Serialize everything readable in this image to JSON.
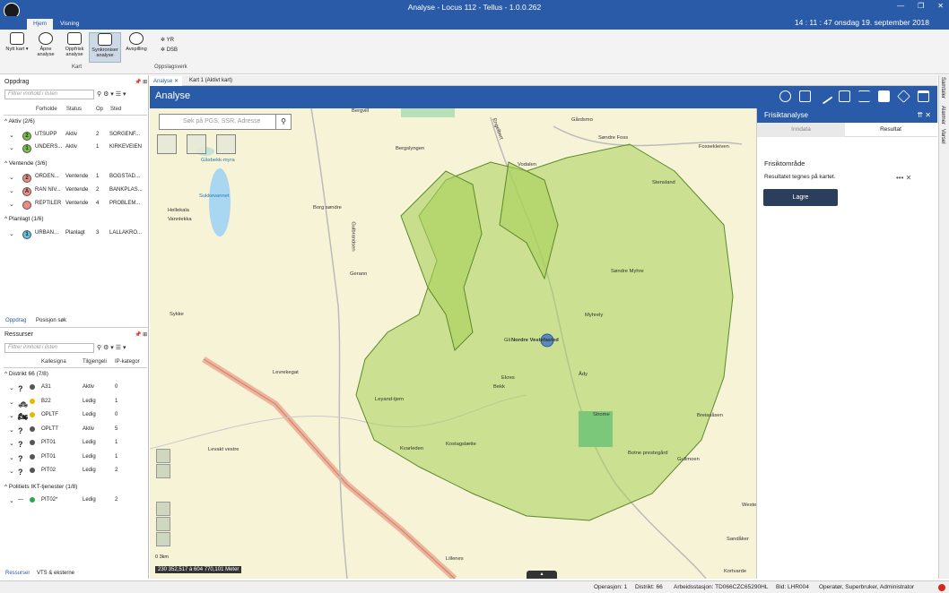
{
  "window": {
    "title": "Analyse - Locus 112 - Tellus - 1.0.0.262",
    "clock": "14 : 11 : 47 onsdag 19. september 2018",
    "controls": [
      "—",
      "❐",
      "✕"
    ]
  },
  "ribbon": {
    "tabs": [
      "Hjem",
      "Visning"
    ],
    "buttons": [
      {
        "label": "Nytt kart ▾"
      },
      {
        "label": "Åpne analyse"
      },
      {
        "label": "Oppfrisk analyse"
      },
      {
        "label": "Synkroniser analyse"
      },
      {
        "label": "Avspilling"
      }
    ],
    "group_kart": "Kart",
    "oppslag": [
      "YR",
      "DSB"
    ],
    "group_oppslag": "Oppslagsverk"
  },
  "oppdrag": {
    "title": "Oppdrag",
    "pin": "📌 ⊞",
    "filter_placeholder": "Filtrer innhold i listen",
    "icons": "⚲ ⚙ ▾ ☰ ▾",
    "columns": [
      "Forholde",
      "Status",
      "Op",
      "Sted"
    ],
    "groups": [
      {
        "title": "Aktiv (2/6)",
        "rows": [
          {
            "badge": "2",
            "color": "#7ac142",
            "name": "UTSUPP",
            "status": "Aktiv",
            "op": "2",
            "sted": "SORGENF..."
          },
          {
            "badge": "1",
            "color": "#7ac142",
            "name": "UNDERS...",
            "status": "Aktiv",
            "op": "1",
            "sted": "KIRKEVEIEN"
          }
        ]
      },
      {
        "title": "Ventende (3/6)",
        "rows": [
          {
            "badge": "2",
            "color": "#f08a7e",
            "name": "ORDEN...",
            "status": "Ventende",
            "op": "1",
            "sted": "BOGSTAD..."
          },
          {
            "badge": "A",
            "color": "#f08a7e",
            "name": "RAN NIV...",
            "status": "Ventende",
            "op": "2",
            "sted": "BANKPLAS..."
          },
          {
            "badge": "",
            "color": "#f08a7e",
            "name": "REPTILER",
            "status": "Ventende",
            "op": "4",
            "sted": "PROBLEM..."
          }
        ]
      },
      {
        "title": "Planlagt (1/6)",
        "rows": [
          {
            "badge": "1",
            "color": "#5bc0de",
            "name": "URBAN...",
            "status": "Planlagt",
            "op": "3",
            "sted": "LALLAKRO..."
          }
        ]
      }
    ],
    "tabs": [
      "Oppdrag",
      "Posisjon søk"
    ]
  },
  "ressurser": {
    "title": "Ressurser",
    "filter_placeholder": "Filtrer innhold i listen",
    "columns": [
      "Kallesigna",
      "Tilgjengeli",
      "IP-kategor"
    ],
    "groups": [
      {
        "title": "Distrikt 66 (7/8)",
        "rows": [
          {
            "icon": "?",
            "dot": "#555",
            "name": "A31",
            "status": "Aktiv",
            "ip": "0"
          },
          {
            "icon": "🚓",
            "dot": "#e6b800",
            "name": "B22",
            "status": "Ledig",
            "ip": "1"
          },
          {
            "icon": "🏍",
            "dot": "#e6b800",
            "name": "OPLTF",
            "status": "Ledig",
            "ip": "0"
          },
          {
            "icon": "?",
            "dot": "#555",
            "name": "OPLTT",
            "status": "Aktiv",
            "ip": "5"
          },
          {
            "icon": "?",
            "dot": "#555",
            "name": "PIT01",
            "status": "Ledig",
            "ip": "1"
          },
          {
            "icon": "?",
            "dot": "#555",
            "name": "PIT01",
            "status": "Ledig",
            "ip": "1"
          },
          {
            "icon": "?",
            "dot": "#555",
            "name": "PIT02",
            "status": "Ledig",
            "ip": "2"
          }
        ]
      },
      {
        "title": "Politiets IKT-tjenester (1/8)",
        "rows": [
          {
            "icon": "—",
            "dot": "#2aa84a",
            "name": "PIT02*",
            "status": "Ledig",
            "ip": "2"
          }
        ]
      }
    ],
    "tabs": [
      "Ressurser",
      "VTS & eksterne"
    ]
  },
  "map": {
    "tabs": [
      "Analyse",
      "Kart 1 (Aktivt kart)"
    ],
    "header": "Analyse",
    "search_placeholder": "Søk på PGS, SSR, Adresse",
    "labels": [
      "Bergvill",
      "Bergslyngen",
      "Gåsbekk-myra",
      "Sukkevannet",
      "Hellekala",
      "Vannlekka",
      "Borg søndre",
      "Gulbrandsen",
      "Gerann",
      "Sykke",
      "Levrekegat",
      "Leyand-tjern",
      "Kvarleden",
      "Kostagslætte",
      "Levakt vestre",
      "Nordre Vestefasted",
      "Gli",
      "Myhrely",
      "Søndre Myhre",
      "Ådy",
      "Ekres",
      "Bekk",
      "Strome",
      "Botne prestegård",
      "Gullmoen",
      "Kortvarde",
      "Sandåker",
      "Fossekleiven",
      "Søndre Foss",
      "Gårdsmo",
      "Stensland",
      "Engelbert",
      "Breiasåsen",
      "Westeråsen",
      "Lillenes",
      "Vodalen"
    ],
    "scale": "0    3km",
    "coords": "230 352,517 à 604 770,101 Meter"
  },
  "frisikt": {
    "title": "Frisiktanalyse",
    "tabs": [
      "Inndata",
      "Resultat"
    ],
    "heading": "Frisiktområde",
    "text": "Resultatet tegnes på kartet.",
    "button": "Lagre",
    "more": "•••  ✕",
    "hcontrols": "⇈  ✕"
  },
  "rightbar": [
    "Samtaler",
    "Alarmer",
    "Varsel"
  ],
  "status": {
    "operasjon": "Operasjon: 1",
    "distrikt": "Distrikt: 66",
    "station": "Arbeidsstasjon: TD066CZC65290HL",
    "bid": "Bid: LHR004",
    "user": "Operatør, Superbruker, Administrator"
  },
  "colors": {
    "primary": "#2a5ba8",
    "viewshed": "#a8d05a",
    "map_bg": "#f7f3d6"
  }
}
